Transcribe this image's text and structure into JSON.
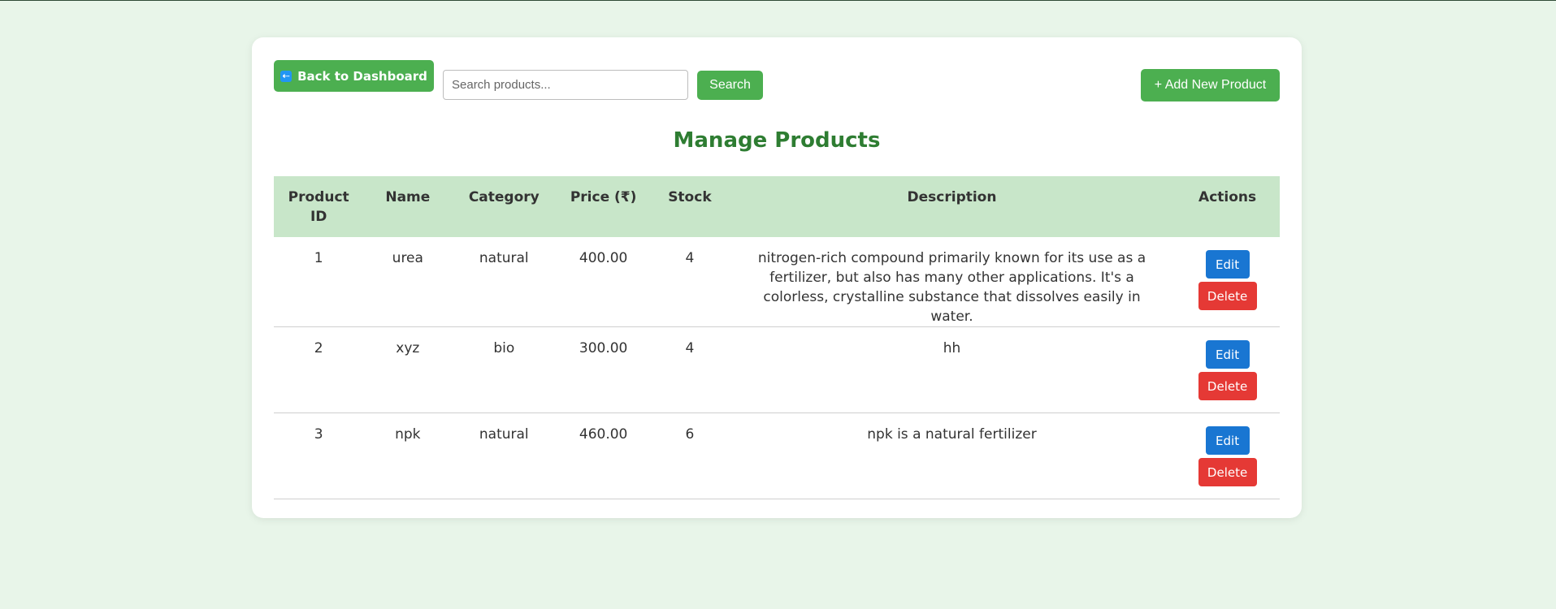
{
  "toolbar": {
    "back_label": "Back to Dashboard",
    "back_icon": "arrow-left-icon",
    "search_placeholder": "Search products...",
    "search_value": "",
    "search_label": "Search",
    "add_label": "+ Add New Product"
  },
  "page": {
    "title": "Manage Products"
  },
  "table": {
    "headers": {
      "id": "Product ID",
      "name": "Name",
      "category": "Category",
      "price": "Price (₹)",
      "stock": "Stock",
      "description": "Description",
      "actions": "Actions"
    },
    "rows": [
      {
        "id": "1",
        "name": "urea",
        "category": "natural",
        "price": "400.00",
        "stock": "4",
        "description": "nitrogen-rich compound primarily known for its use as a fertilizer, but also has many other applications. It's a colorless, crystalline substance that dissolves easily in water.",
        "edit_label": "Edit",
        "delete_label": "Delete"
      },
      {
        "id": "2",
        "name": "xyz",
        "category": "bio",
        "price": "300.00",
        "stock": "4",
        "description": "hh",
        "edit_label": "Edit",
        "delete_label": "Delete"
      },
      {
        "id": "3",
        "name": "npk",
        "category": "natural",
        "price": "460.00",
        "stock": "6",
        "description": "npk is a natural fertilizer",
        "edit_label": "Edit",
        "delete_label": "Delete"
      }
    ]
  },
  "colors": {
    "background": "#e8f5e9",
    "primary_green": "#4caf50",
    "title_green": "#2e7d32",
    "header_row": "#c8e6c9",
    "edit_blue": "#1976d2",
    "delete_red": "#e53935"
  }
}
